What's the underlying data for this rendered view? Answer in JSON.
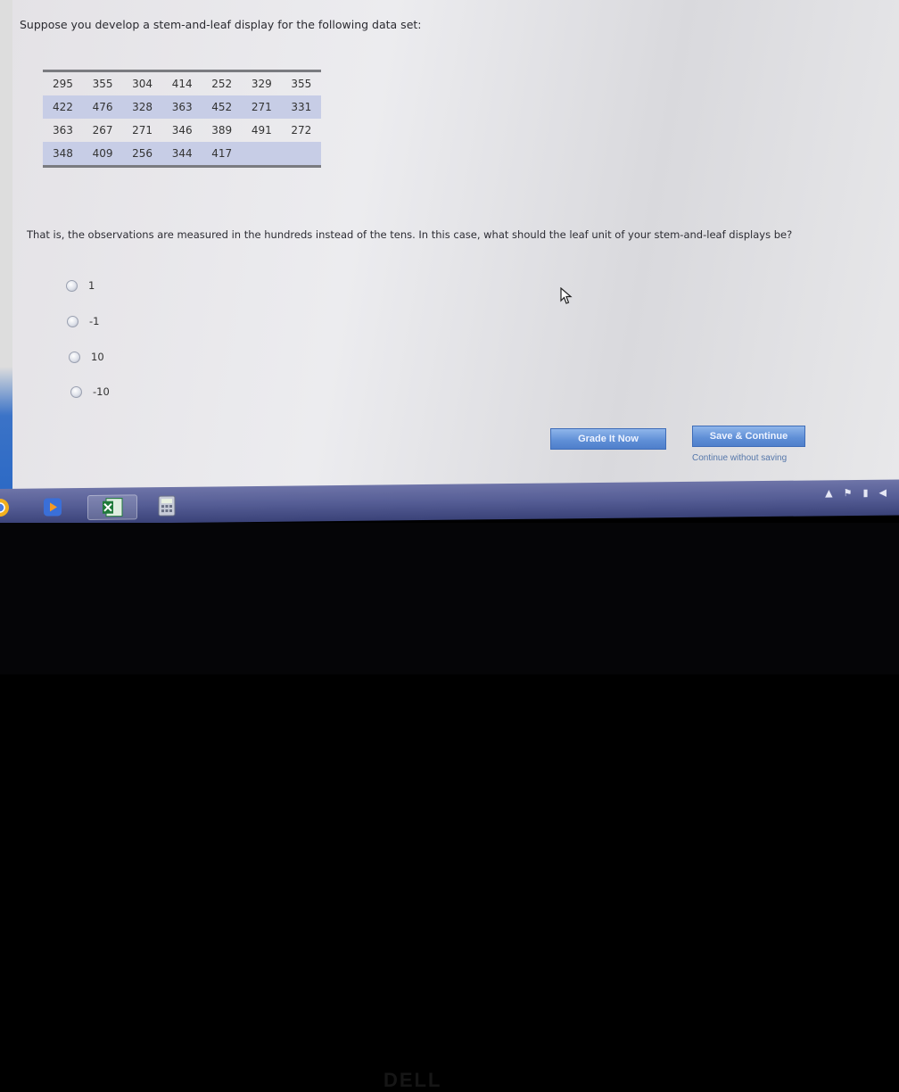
{
  "question": {
    "intro": "Suppose you develop a stem-and-leaf display for the following data set:",
    "data_rows": [
      [
        "295",
        "355",
        "304",
        "414",
        "252",
        "329",
        "355"
      ],
      [
        "422",
        "476",
        "328",
        "363",
        "452",
        "271",
        "331"
      ],
      [
        "363",
        "267",
        "271",
        "346",
        "389",
        "491",
        "272"
      ],
      [
        "348",
        "409",
        "256",
        "344",
        "417",
        "",
        ""
      ]
    ],
    "body": "That is, the observations are measured in the hundreds instead of the tens. In this case, what should the leaf unit of your stem-and-leaf displays be?",
    "options": [
      "1",
      "-1",
      "10",
      "-10"
    ]
  },
  "actions": {
    "grade_label": "Grade It Now",
    "save_label": "Save & Continue",
    "continue_link": "Continue without saving"
  },
  "taskbar": {
    "icons": [
      "browser-icon",
      "media-player-icon",
      "excel-icon",
      "calculator-icon"
    ]
  },
  "bezel": {
    "brand": "DELL"
  }
}
